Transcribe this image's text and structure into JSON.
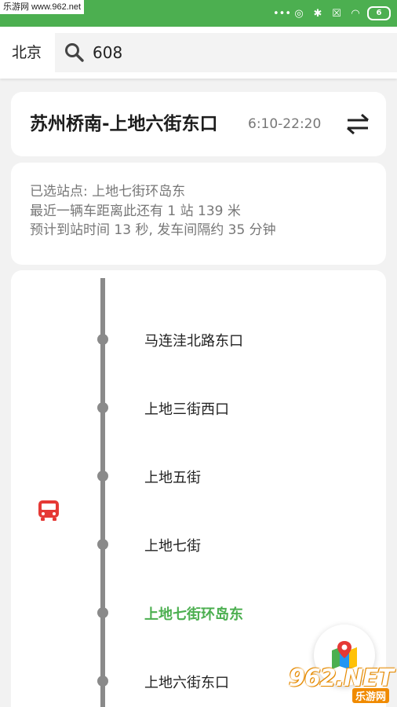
{
  "status_bar": {
    "watermark": "乐游网 www.962.net",
    "battery": "6",
    "background": "#4caf50"
  },
  "search": {
    "city": "北京",
    "query": "608"
  },
  "route": {
    "name": "苏州桥南-上地六街东口",
    "hours": "6:10-22:20"
  },
  "info": {
    "selected_stop": "已选站点: 上地七街环岛东",
    "nearest_bus": "最近一辆车距离此还有 1 站 139 米",
    "eta": "预计到站时间 13 秒, 发车间隔约 35 分钟"
  },
  "stops": [
    {
      "name": "马连洼北路东口",
      "current": false
    },
    {
      "name": "上地三街西口",
      "current": false
    },
    {
      "name": "上地五街",
      "current": false
    },
    {
      "name": "上地七街",
      "current": false
    },
    {
      "name": "上地七街环岛东",
      "current": true
    },
    {
      "name": "上地六街东口",
      "current": false
    }
  ],
  "watermark_logo": {
    "main": "962.NET",
    "sub": "乐游网"
  },
  "colors": {
    "accent": "#4caf50",
    "bus": "#e53935",
    "track": "#8a8a8a"
  }
}
